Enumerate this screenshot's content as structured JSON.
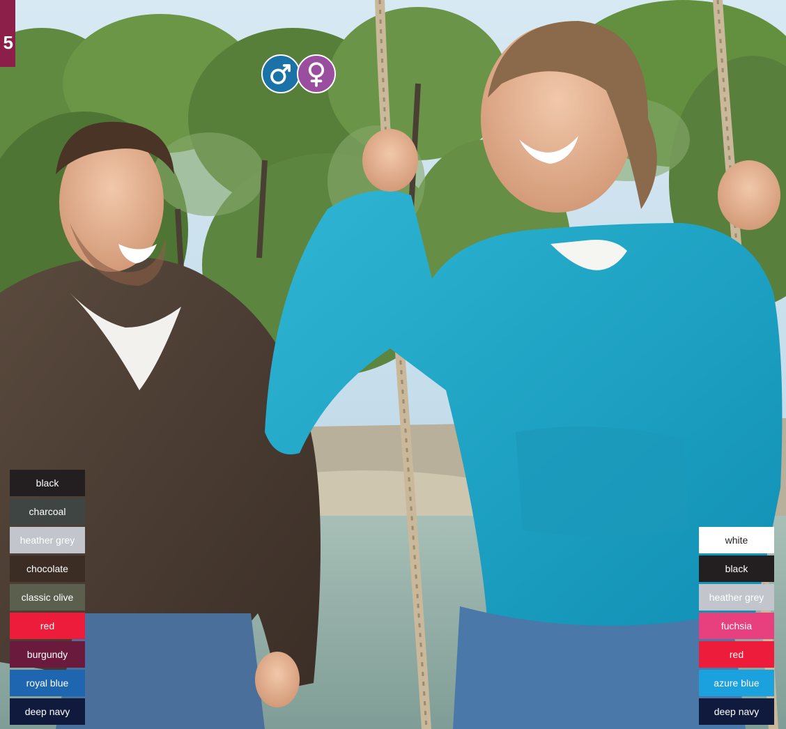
{
  "page_marker": {
    "text": "5",
    "color": "#8c1f4a"
  },
  "gender_icons": {
    "male": {
      "name": "male-symbol-icon",
      "color": "#1a72a6"
    },
    "female": {
      "name": "female-symbol-icon",
      "color": "#9a4f9e"
    }
  },
  "left_swatches": [
    {
      "label": "black",
      "bg": "#231f20",
      "fg": "#ffffff"
    },
    {
      "label": "charcoal",
      "bg": "#3f4542",
      "fg": "#ffffff"
    },
    {
      "label": "heather grey",
      "bg": "#c2c6cc",
      "fg": "#ffffff"
    },
    {
      "label": "chocolate",
      "bg": "#3b2d24",
      "fg": "#ffffff"
    },
    {
      "label": "classic olive",
      "bg": "#5a604d",
      "fg": "#ffffff"
    },
    {
      "label": "red",
      "bg": "#ed1c3a",
      "fg": "#ffffff"
    },
    {
      "label": "burgundy",
      "bg": "#6a1b3d",
      "fg": "#ffffff"
    },
    {
      "label": "royal blue",
      "bg": "#1f66b1",
      "fg": "#ffffff"
    },
    {
      "label": "deep navy",
      "bg": "#0f1a3d",
      "fg": "#ffffff"
    }
  ],
  "right_swatches": [
    {
      "label": "white",
      "bg": "#ffffff",
      "fg": "#231f20"
    },
    {
      "label": "black",
      "bg": "#231f20",
      "fg": "#ffffff"
    },
    {
      "label": "heather grey",
      "bg": "#c2c6cc",
      "fg": "#ffffff"
    },
    {
      "label": "fuchsia",
      "bg": "#e8407f",
      "fg": "#ffffff"
    },
    {
      "label": "red",
      "bg": "#ed1c3a",
      "fg": "#ffffff"
    },
    {
      "label": "azure blue",
      "bg": "#1ba1de",
      "fg": "#ffffff"
    },
    {
      "label": "deep navy",
      "bg": "#0f1a3d",
      "fg": "#ffffff"
    }
  ]
}
